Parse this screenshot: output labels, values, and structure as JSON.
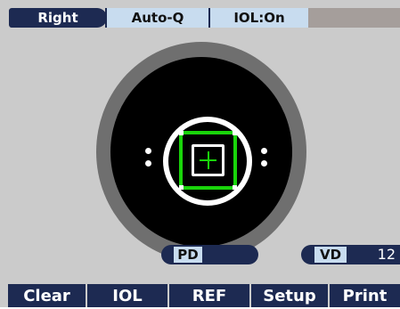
{
  "status_bar": {
    "eye_side": "Right",
    "auto_q": "Auto-Q",
    "iol": "IOL:On"
  },
  "readouts": {
    "pd_label": "PD",
    "vd_label": "VD",
    "vd_value": "12"
  },
  "buttons": {
    "clear": "Clear",
    "iol": "IOL",
    "ref": "REF",
    "setup": "Setup",
    "print": "Print"
  },
  "colors": {
    "navy": "#1d2a52",
    "light_blue": "#c8dcef",
    "alignment_green": "#19d40a",
    "background": "#cbcbcb"
  }
}
